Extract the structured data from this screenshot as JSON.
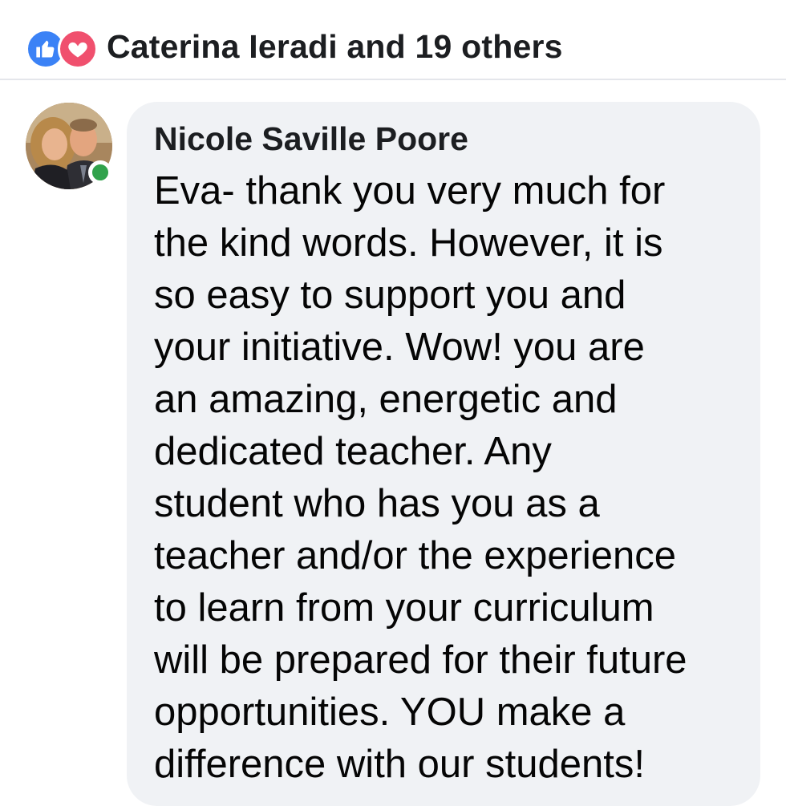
{
  "reactions": {
    "summary_text": "Caterina Ieradi and 19 others",
    "icons": [
      "like-icon",
      "love-icon"
    ],
    "like_color": "#3b82f6",
    "love_color": "#f0506e"
  },
  "comment": {
    "author": "Nicole Saville Poore",
    "body": "Eva- thank you very much for\nthe kind words.  However, it is\nso easy to support you and\nyour initiative.  Wow! you are\nan amazing, energetic and\ndedicated teacher.  Any\nstudent who has you as a\nteacher and/or the experience\nto learn from your curriculum\nwill be prepared for their future\nopportunities.  YOU make a\ndifference with our students!",
    "online": true,
    "presence_color": "#31a24c",
    "bubble_color": "#f0f2f5"
  }
}
